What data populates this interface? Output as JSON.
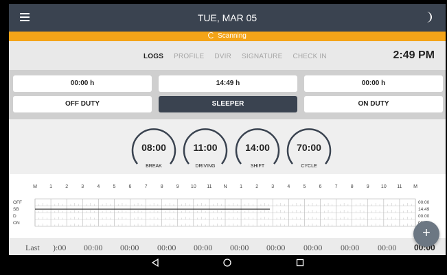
{
  "header": {
    "date": "TUE, MAR 05",
    "menu_icon": "hamburger-menu-icon",
    "theme_icon": "moon-icon"
  },
  "scanning": {
    "label": "Scanning",
    "color": "#f4a418"
  },
  "tabs": [
    {
      "label": "LOGS",
      "active": true
    },
    {
      "label": "PROFILE",
      "active": false
    },
    {
      "label": "DVIR",
      "active": false
    },
    {
      "label": "SIGNATURE",
      "active": false
    },
    {
      "label": "CHECK IN",
      "active": false
    }
  ],
  "clock": "2:49 PM",
  "status": {
    "off_duty_time": "00:00 h",
    "sleeper_time": "14:49 h",
    "on_duty_time": "00:00 h",
    "off_duty_label": "OFF DUTY",
    "sleeper_label": "SLEEPER",
    "on_duty_label": "ON DUTY",
    "active_status": "SLEEPER"
  },
  "gauges": [
    {
      "value": "08:00",
      "label": "BREAK"
    },
    {
      "value": "11:00",
      "label": "DRIVING"
    },
    {
      "value": "14:00",
      "label": "SHIFT"
    },
    {
      "value": "70:00",
      "label": "CYCLE"
    }
  ],
  "chart_data": {
    "type": "line",
    "hour_labels": [
      "M",
      "1",
      "2",
      "3",
      "4",
      "5",
      "6",
      "7",
      "8",
      "9",
      "10",
      "11",
      "N",
      "1",
      "2",
      "3",
      "4",
      "5",
      "6",
      "7",
      "8",
      "9",
      "10",
      "11",
      "M"
    ],
    "rows": [
      "OFF",
      "SB",
      "D",
      "ON"
    ],
    "row_totals": [
      "00:00",
      "14:49",
      "00:00",
      "00:00"
    ],
    "series": [
      {
        "row": "SB",
        "start_hour": 0,
        "end_hour": 14.82
      }
    ]
  },
  "footer": {
    "label": "Last",
    "values": [
      ")​:00",
      "00:00",
      "00:00",
      "00:00",
      "00:00",
      "00:00",
      "00:00",
      "00:00",
      "00:00",
      "00:00",
      "00:00"
    ]
  },
  "colors": {
    "header_bg": "#3a4350",
    "accent": "#f4a418",
    "fab": "#6c7783"
  }
}
